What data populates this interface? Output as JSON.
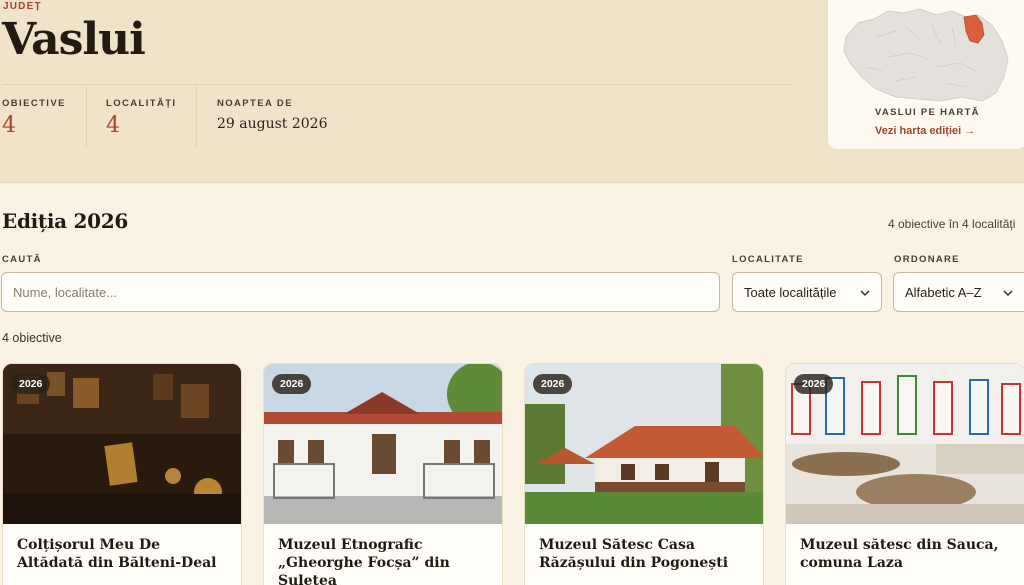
{
  "hero": {
    "county_label": "JUDEȚ",
    "county_name": "Vaslui",
    "stats": [
      {
        "label": "OBIECTIVE",
        "value": "4"
      },
      {
        "label": "LOCALITĂȚI",
        "value": "4"
      },
      {
        "label": "NOAPTEA DE",
        "value": "29 august 2026"
      }
    ]
  },
  "map_card": {
    "caption": "VASLUI PE HARTĂ",
    "link": "Vezi harta ediției →",
    "highlight_color": "#d9603b"
  },
  "edition": {
    "title": "Ediția 2026",
    "summary": "4 obiective în 4 localități"
  },
  "filters": {
    "search_label": "CAUTĂ",
    "search_placeholder": "Nume, localitate...",
    "locality_label": "LOCALITATE",
    "locality_value": "Toate localitățile",
    "sort_label": "ORDONARE",
    "sort_value": "Alfabetic A–Z"
  },
  "results": {
    "count_text": "4 obiective"
  },
  "cards": [
    {
      "badge": "2026",
      "title": "Colțișorul Meu De Altădată din Bălteni-Deal"
    },
    {
      "badge": "2026",
      "title": "Muzeul Etnografic „Gheorghe Focșa” din Șuletea"
    },
    {
      "badge": "2026",
      "title": "Muzeul Sătesc Casa Răzășului din Pogonești"
    },
    {
      "badge": "2026",
      "title": "Muzeul sătesc din Sauca, comuna Laza"
    }
  ],
  "colors": {
    "accent": "#a8432c",
    "hero_bg": "#f1e3c9",
    "page_bg": "#faf3e4"
  }
}
